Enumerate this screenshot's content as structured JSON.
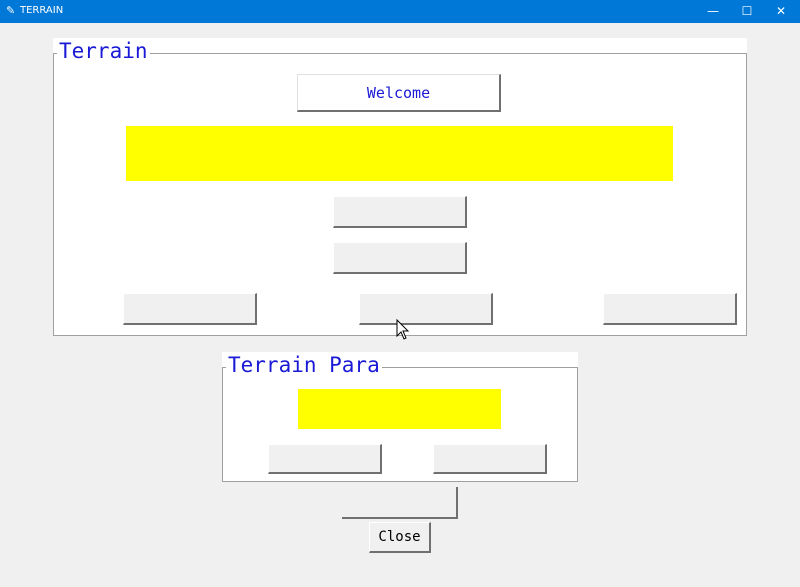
{
  "window": {
    "title": "TERRAIN",
    "icon": "feather-icon",
    "controls": {
      "minimize": "—",
      "maximize": "☐",
      "close": "✕"
    }
  },
  "terrain_frame": {
    "legend": "Terrain",
    "welcome_button": "Welcome",
    "buttons": [
      "",
      "",
      "",
      "",
      ""
    ]
  },
  "para_frame": {
    "legend": "Terrain Para",
    "buttons": [
      "",
      ""
    ]
  },
  "bottom": {
    "empty_button": "",
    "close_button": "Close"
  },
  "colors": {
    "titlebar": "#0078d7",
    "legend_text": "#1a1ad6",
    "highlight": "#ffff00"
  }
}
